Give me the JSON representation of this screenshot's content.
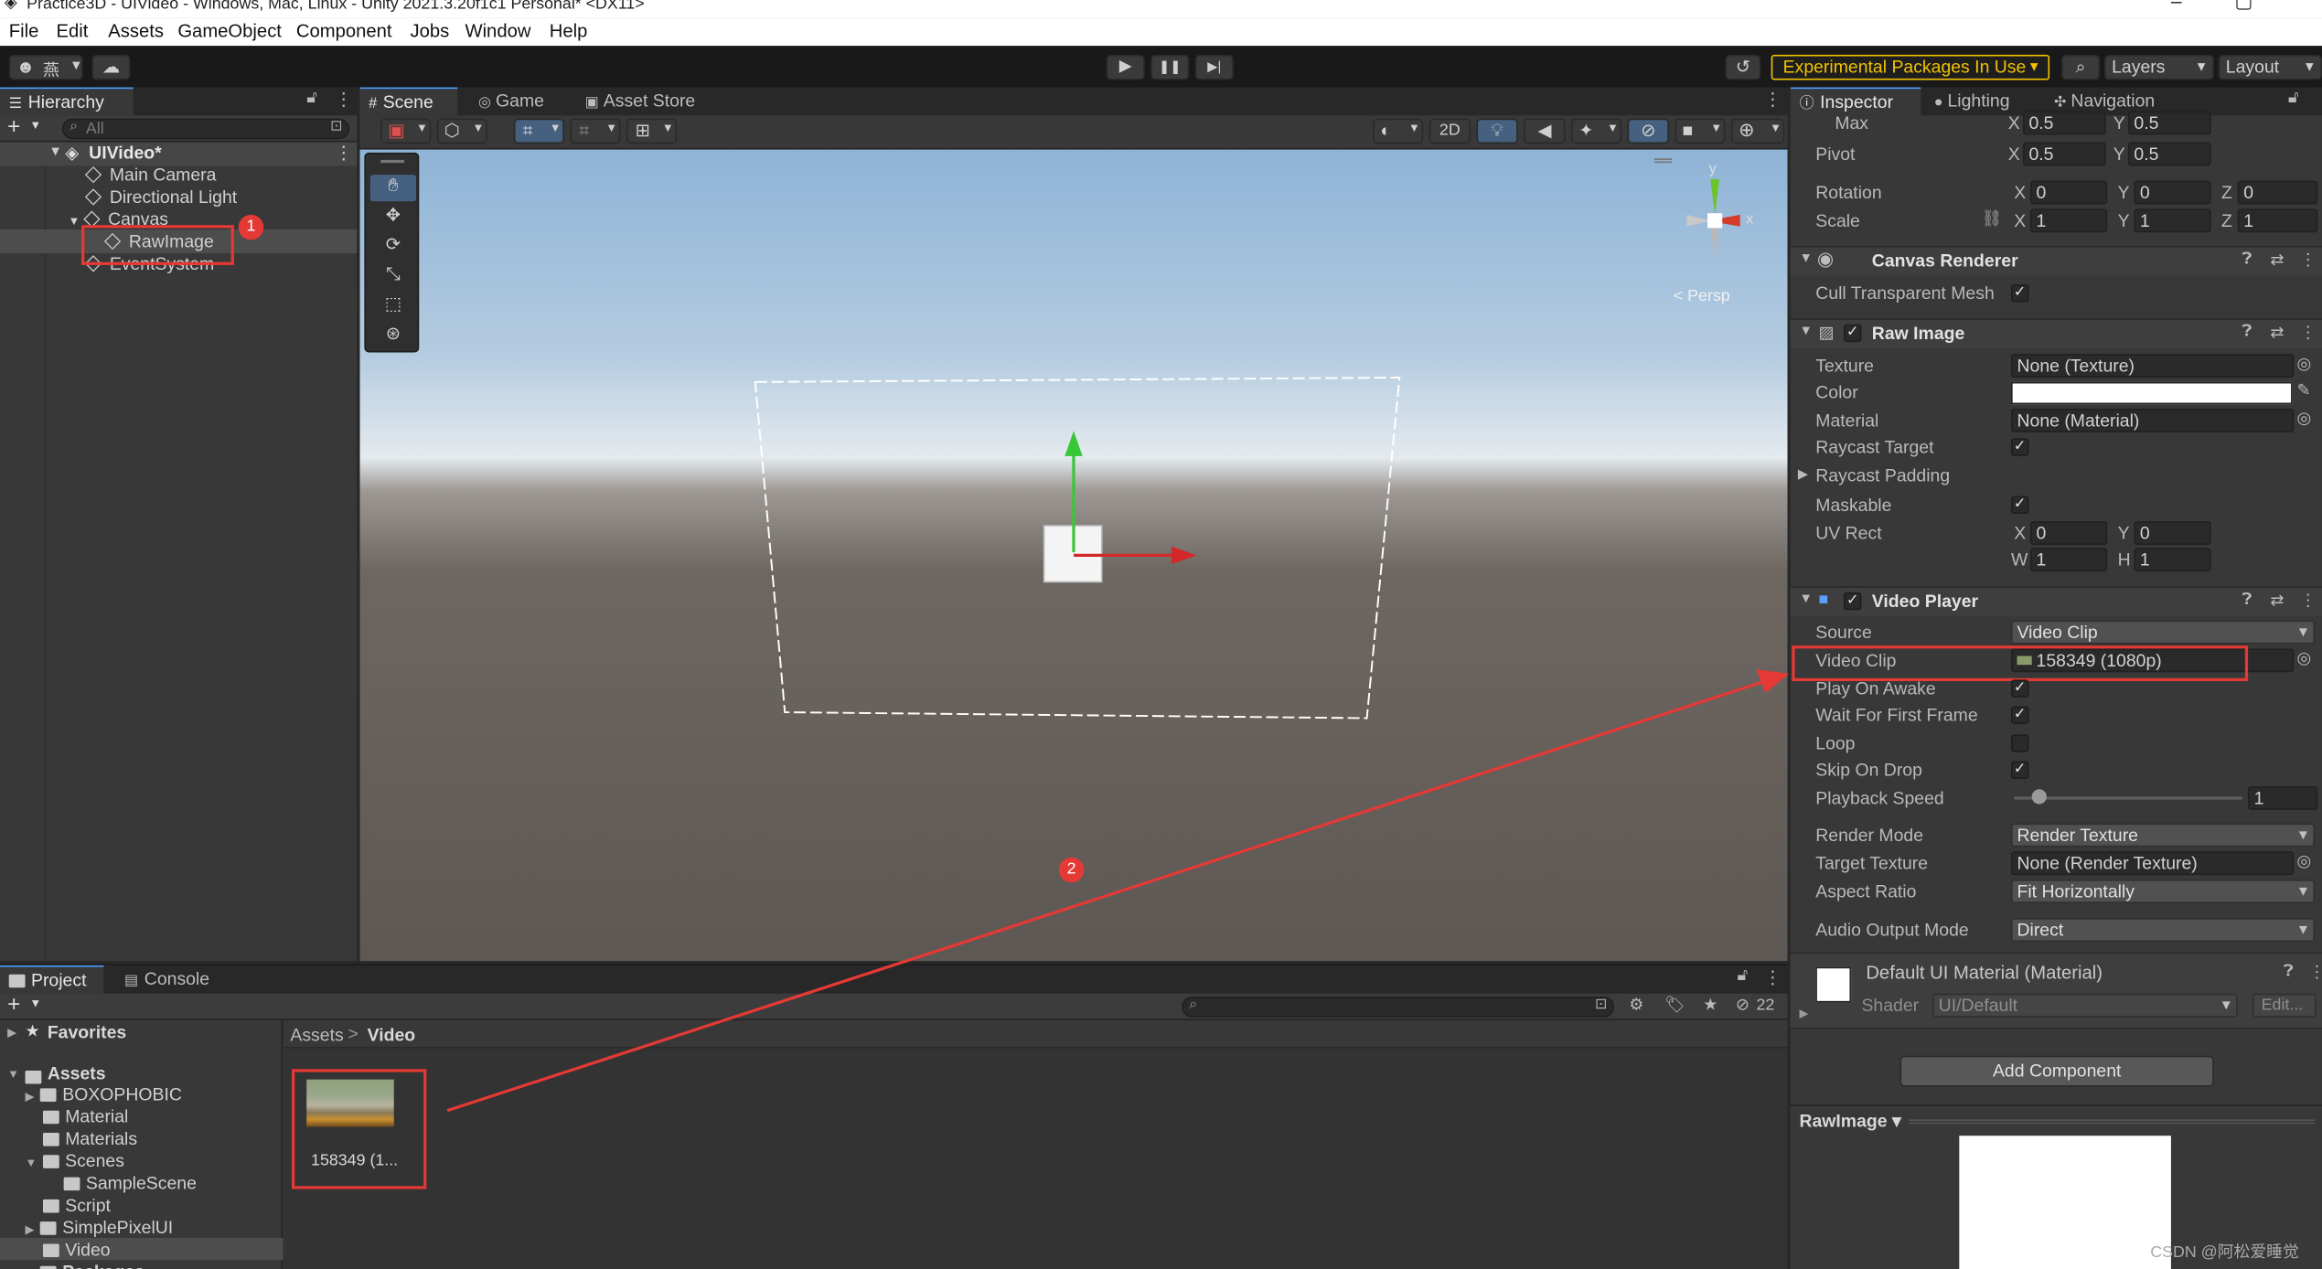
{
  "window": {
    "title": "Practice3D - UIVideo - Windows, Mac, Linux - Unity 2021.3.20f1c1 Personal* <DX11>",
    "controls": [
      "–",
      "▢"
    ]
  },
  "menu": [
    "File",
    "Edit",
    "Assets",
    "GameObject",
    "Component",
    "Jobs",
    "Window",
    "Help"
  ],
  "toolbar": {
    "account_label": "燕",
    "experimental_label": "Experimental Packages In Use",
    "layers_label": "Layers",
    "layout_label": "Layout",
    "play_glyph": "▶",
    "pause_glyph": "❚❚",
    "step_glyph": "▶|",
    "history_glyph": "↺",
    "search_glyph": "⌕",
    "cloud_glyph": "☁"
  },
  "hierarchy": {
    "tab": "Hierarchy",
    "search_placeholder": "All",
    "scene": "UIVideo*",
    "items": [
      {
        "label": "Main Camera"
      },
      {
        "label": "Directional Light"
      },
      {
        "label": "Canvas"
      },
      {
        "label": "RawImage"
      },
      {
        "label": "EventSystem"
      }
    ],
    "badge": "1"
  },
  "scene_view": {
    "tabs": [
      "Scene",
      "Game",
      "Asset Store"
    ],
    "mode_2d": "2D",
    "gizmo": {
      "x": "x",
      "y": "y",
      "persp": "< Persp"
    },
    "badge": "2"
  },
  "inspector": {
    "tabs": [
      "Inspector",
      "Lighting",
      "Navigation"
    ],
    "rect": {
      "max_label": "Max",
      "max_x": "0.5",
      "max_y": "0.5",
      "pivot_label": "Pivot",
      "pivot_x": "0.5",
      "pivot_y": "0.5",
      "rotation_label": "Rotation",
      "rot_x": "0",
      "rot_y": "0",
      "rot_z": "0",
      "scale_label": "Scale",
      "scale_x": "1",
      "scale_y": "1",
      "scale_z": "1",
      "axis_x": "X",
      "axis_y": "Y",
      "axis_z": "Z",
      "axis_w": "W",
      "axis_h": "H"
    },
    "canvas_renderer": {
      "title": "Canvas Renderer",
      "cull_label": "Cull Transparent Mesh",
      "cull": true
    },
    "raw_image": {
      "title": "Raw Image",
      "texture_label": "Texture",
      "texture": "None (Texture)",
      "color_label": "Color",
      "material_label": "Material",
      "material": "None (Material)",
      "raycast_target_label": "Raycast Target",
      "raycast_padding_label": "Raycast Padding",
      "maskable_label": "Maskable",
      "uvrect_label": "UV Rect",
      "uv_x": "0",
      "uv_y": "0",
      "uv_w": "1",
      "uv_h": "1"
    },
    "video_player": {
      "title": "Video Player",
      "source_label": "Source",
      "source": "Video Clip",
      "clip_label": "Video Clip",
      "clip": "158349 (1080p)",
      "play_on_awake_label": "Play On Awake",
      "wait_first_frame_label": "Wait For First Frame",
      "loop_label": "Loop",
      "skip_on_drop_label": "Skip On Drop",
      "playback_speed_label": "Playback Speed",
      "playback_speed": "1",
      "render_mode_label": "Render Mode",
      "render_mode": "Render Texture",
      "target_texture_label": "Target Texture",
      "target_texture": "None (Render Texture)",
      "aspect_ratio_label": "Aspect Ratio",
      "aspect_ratio": "Fit Horizontally",
      "audio_output_label": "Audio Output Mode",
      "audio_output": "Direct"
    },
    "material": {
      "title": "Default UI Material (Material)",
      "shader_label": "Shader",
      "shader": "UI/Default",
      "edit_label": "Edit..."
    },
    "add_component": "Add Component",
    "preview_label": "RawImage ▾"
  },
  "project": {
    "tabs": [
      "Project",
      "Console"
    ],
    "favorites": "Favorites",
    "assets": "Assets",
    "folders": [
      "BOXOPHOBIC",
      "Material",
      "Materials",
      "Scenes",
      "SampleScene",
      "Script",
      "SimplePixelUI",
      "Video",
      "Packages"
    ],
    "breadcrumb_root": "Assets",
    "breadcrumb_sep": ">",
    "breadcrumb_current": "Video",
    "asset_name": "158349 (1...",
    "hidden_count": "22"
  },
  "watermark": "CSDN @阿松爱睡觉",
  "colors": {
    "accent": "#4a9eff",
    "annotation": "#e53935",
    "experimental": "#f2c200"
  }
}
